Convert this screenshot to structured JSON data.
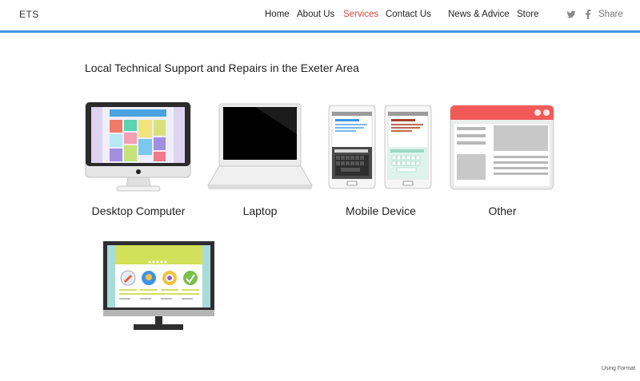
{
  "site": {
    "logo": "ETS"
  },
  "nav": {
    "items": [
      "Home",
      "About Us",
      "Services",
      "Contact Us",
      "News & Advice",
      "Store"
    ],
    "active": "Services"
  },
  "social": {
    "twitter_icon": "twitter-icon",
    "facebook_icon": "facebook-icon",
    "share_label": "Share"
  },
  "main": {
    "heading": "Local Technical Support and Repairs in the Exeter Area",
    "services": [
      {
        "label": "Desktop Computer",
        "icon": "desktop-computer-icon"
      },
      {
        "label": "Laptop",
        "icon": "laptop-icon"
      },
      {
        "label": "Mobile Device",
        "icon": "mobile-device-icon"
      },
      {
        "label": "Other",
        "icon": "browser-window-icon"
      }
    ],
    "extra_icon": "website-monitor-icon"
  },
  "footer": {
    "link": "Using Format"
  },
  "colors": {
    "accent": "#3d94e6",
    "active_nav": "#d9453d"
  }
}
